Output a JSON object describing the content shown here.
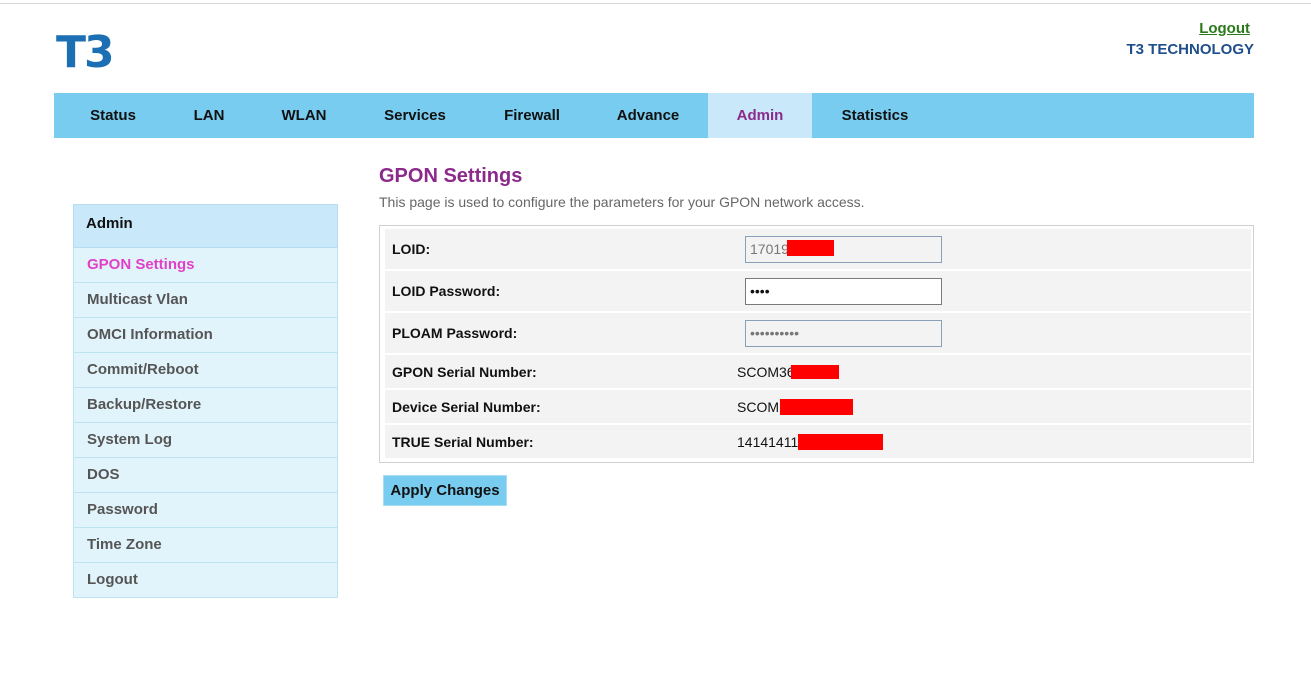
{
  "header": {
    "logo": "T3",
    "logout_label": "Logout",
    "company": "T3 TECHNOLOGY"
  },
  "nav": {
    "items": [
      "Status",
      "LAN",
      "WLAN",
      "Services",
      "Firewall",
      "Advance",
      "Admin",
      "Statistics"
    ],
    "active": "Admin"
  },
  "sidebar": {
    "heading": "Admin",
    "items": [
      "GPON Settings",
      "Multicast Vlan",
      "OMCI Information",
      "Commit/Reboot",
      "Backup/Restore",
      "System Log",
      "DOS",
      "Password",
      "Time Zone",
      "Logout"
    ],
    "active": "GPON Settings"
  },
  "page": {
    "title": "GPON Settings",
    "description": "This page is used to configure the parameters for your GPON network access."
  },
  "form": {
    "loid_label": "LOID:",
    "loid_value": "17019",
    "loid_password_label": "LOID Password:",
    "loid_password_value": "••••",
    "ploam_password_label": "PLOAM Password:",
    "ploam_password_value": "••••••••••",
    "gpon_serial_label": "GPON Serial Number:",
    "gpon_serial_value": "SCOM36",
    "device_serial_label": "Device Serial Number:",
    "device_serial_value": "SCOM",
    "true_serial_label": "TRUE Serial Number:",
    "true_serial_value": "14141411",
    "redaction_color": "#ff0000"
  },
  "apply_button": "Apply Changes",
  "colors": {
    "nav_bg": "#78ccf0",
    "nav_active_bg": "#c9e8fa",
    "title": "#8b2a8b",
    "sidebar_active": "#e040c8",
    "logo": "#1d6fb3"
  }
}
